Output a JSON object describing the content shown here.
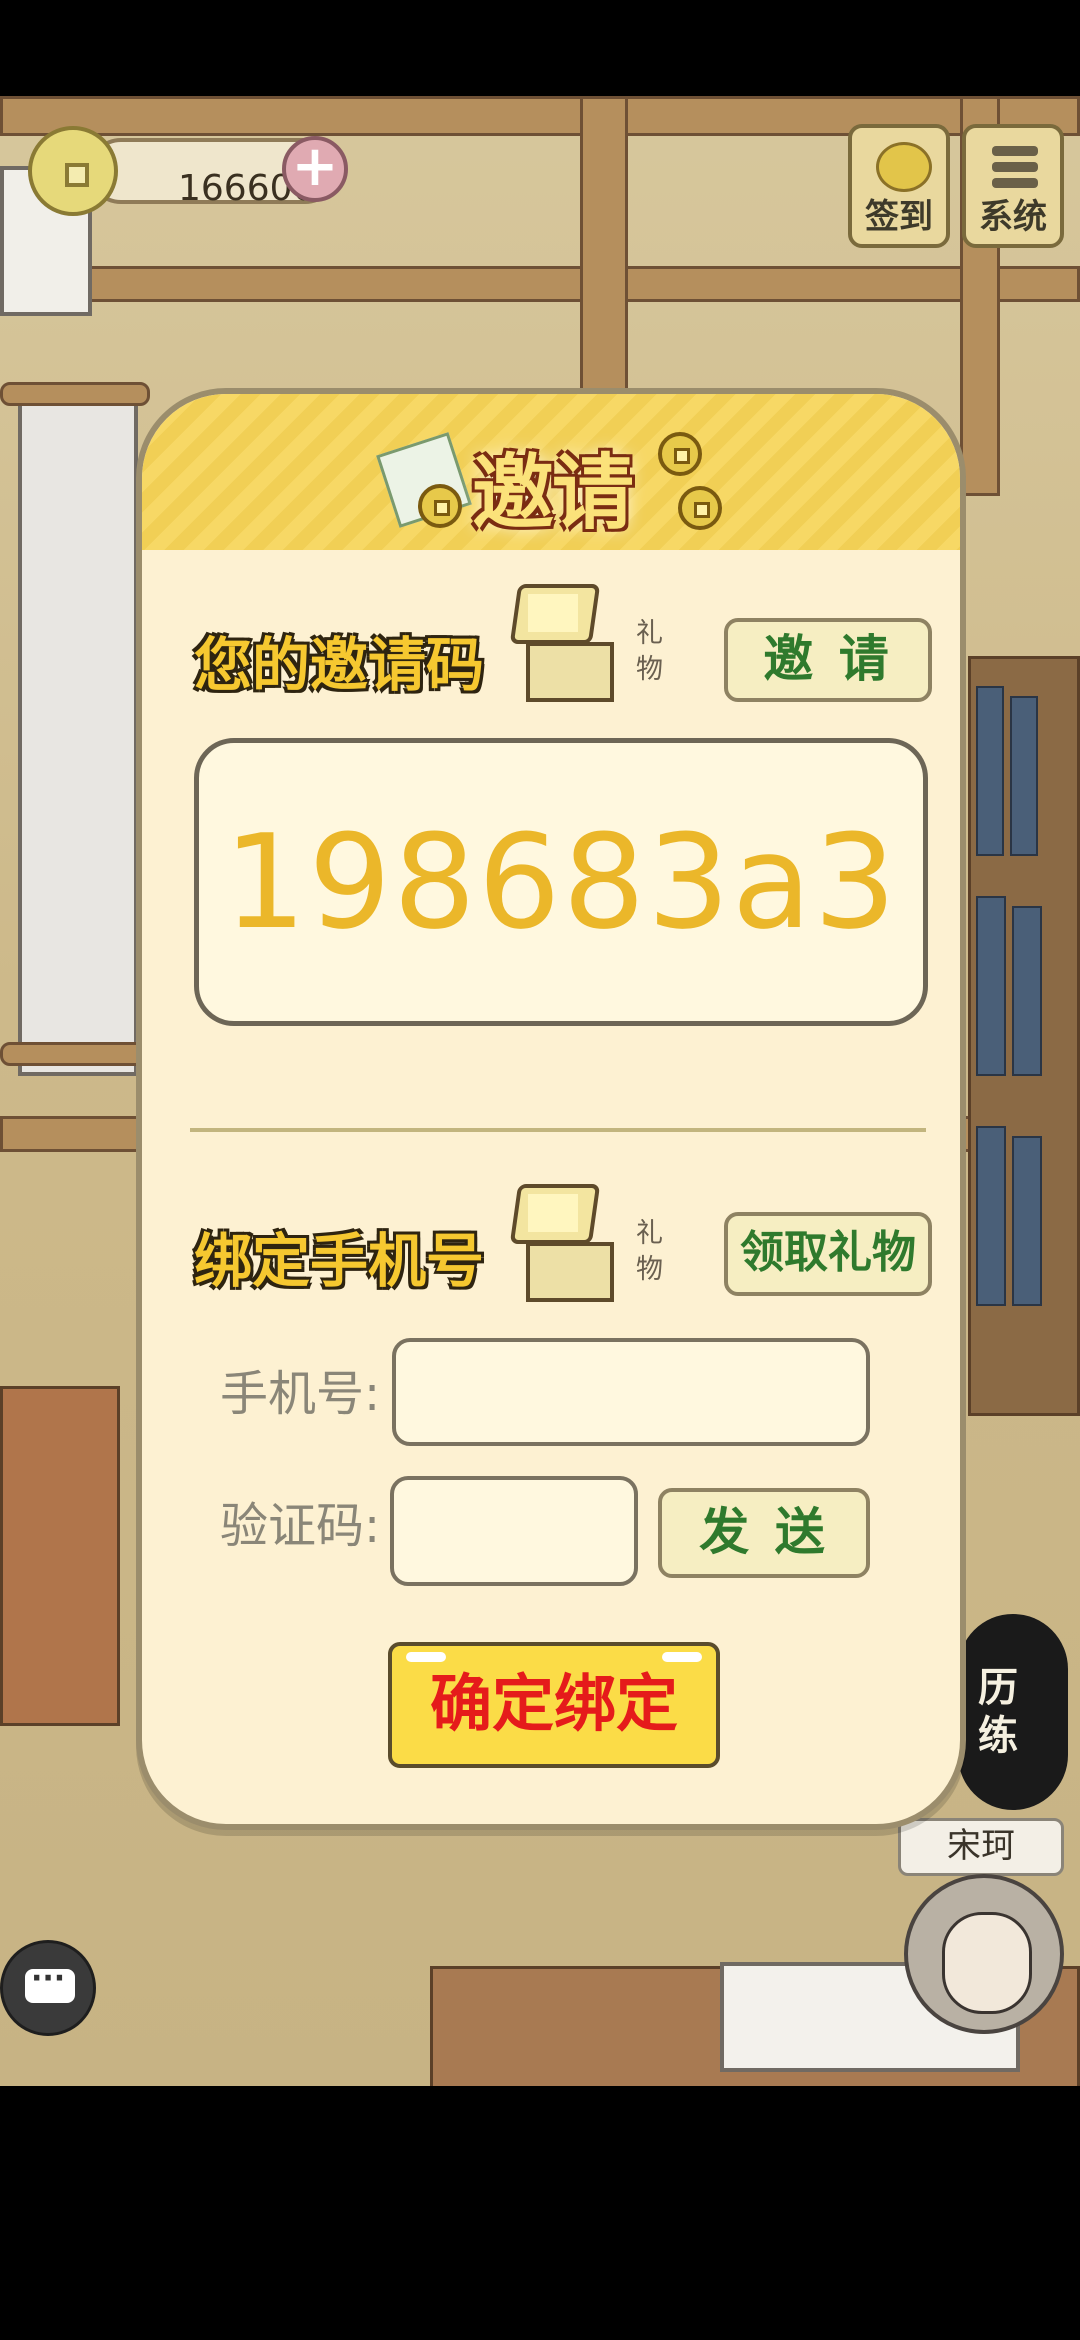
{
  "hud": {
    "coins": "166600",
    "plus_label": "+",
    "checkin_label": "签到",
    "system_label": "系统"
  },
  "dialog": {
    "title": "邀请",
    "invite_section": {
      "title": "您的邀请码",
      "gift_label": "礼物",
      "invite_button": "邀 请",
      "code": "198683a3"
    },
    "bind_section": {
      "title": "绑定手机号",
      "gift_label": "礼物",
      "claim_button": "领取礼物",
      "phone_label": "手机号:",
      "phone_value": "",
      "code_label": "验证码:",
      "code_value": "",
      "send_button": "发 送",
      "confirm_button": "确定绑定"
    }
  },
  "side": {
    "training_label": "历练",
    "character_name": "宋珂"
  }
}
